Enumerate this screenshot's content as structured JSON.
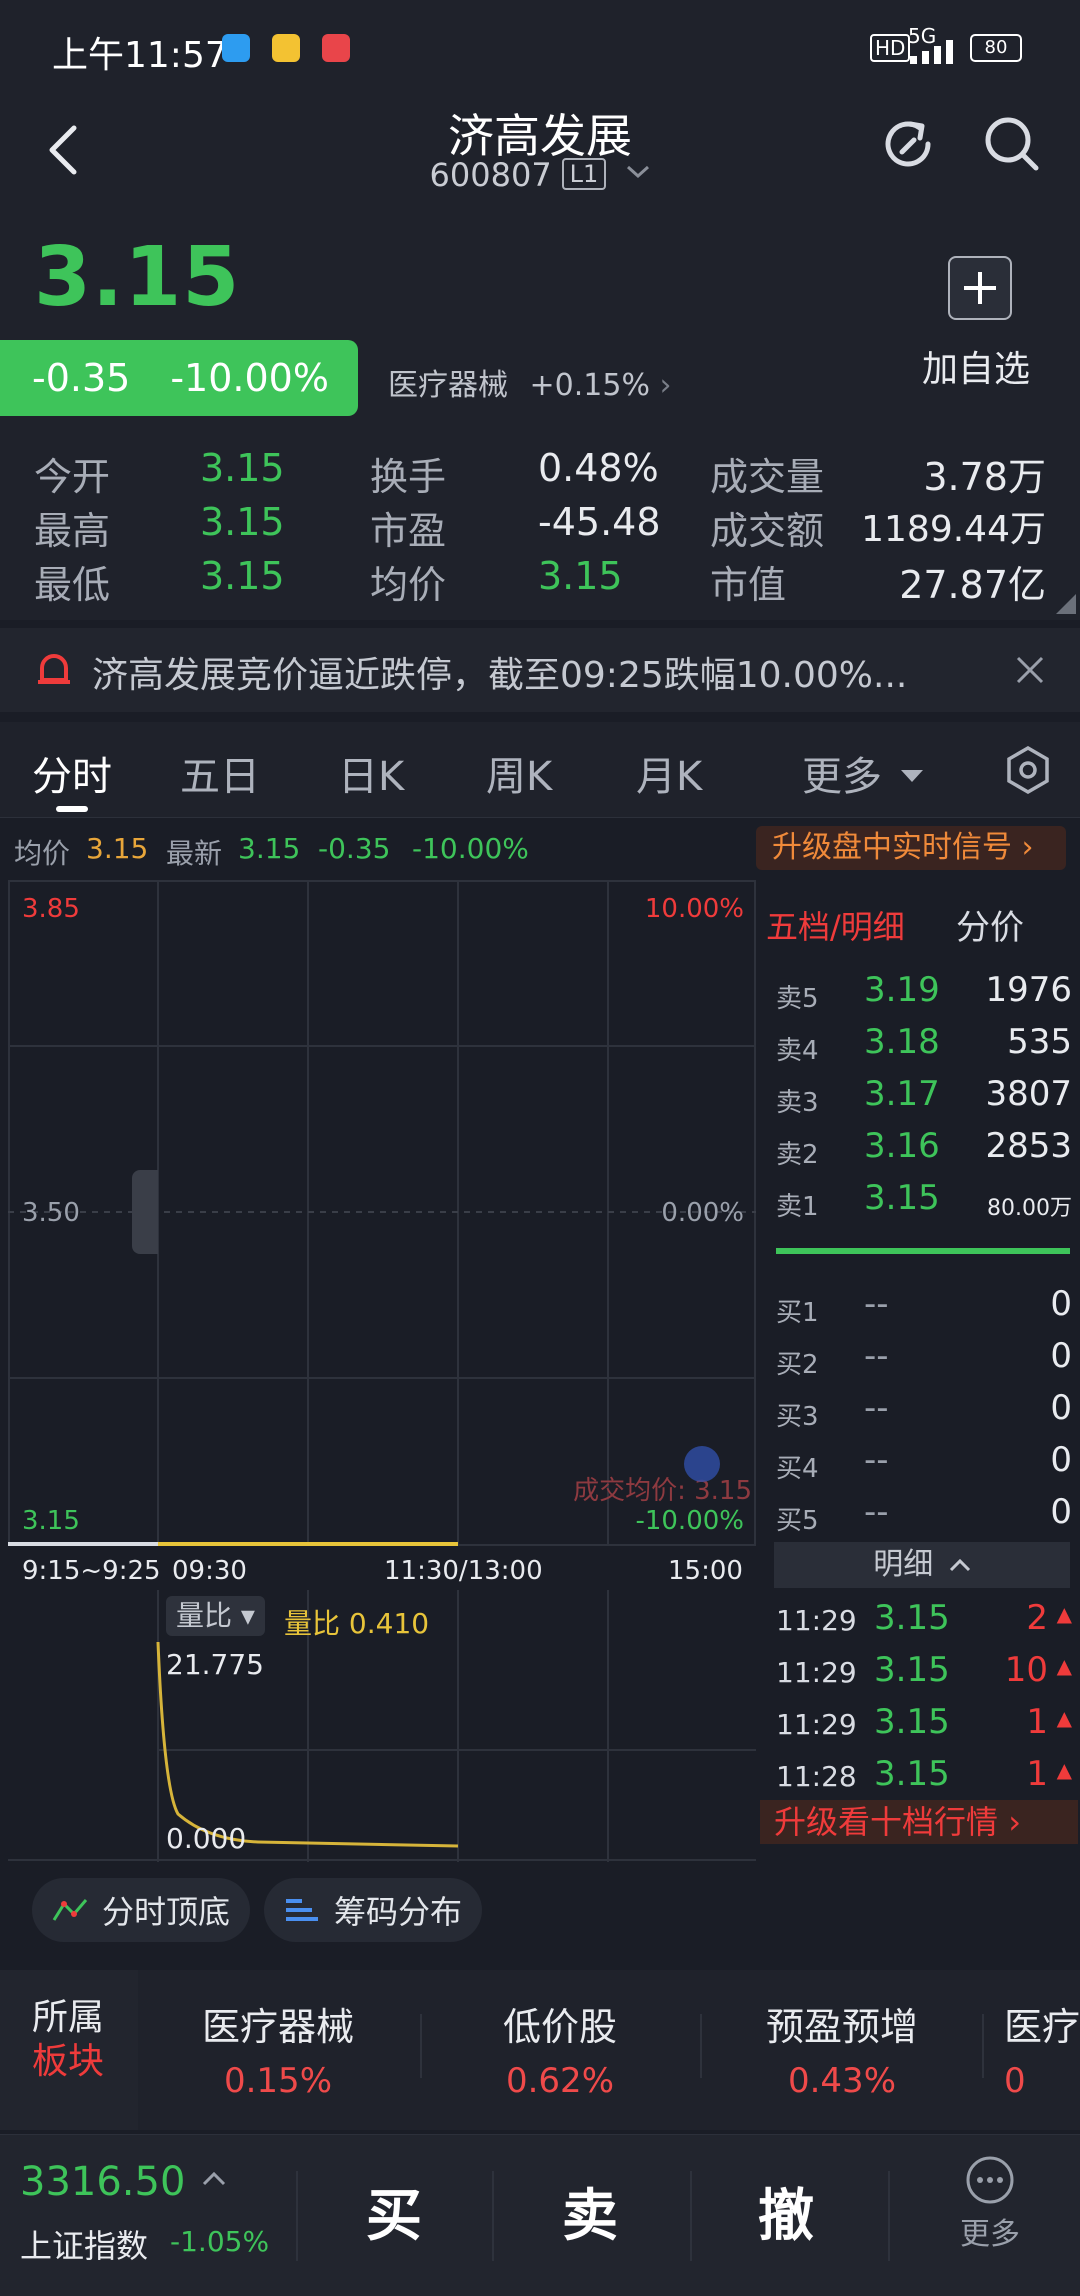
{
  "status_bar": {
    "time": "上午11:57",
    "network": "5G",
    "battery": "80"
  },
  "header": {
    "stock_name": "济高发展",
    "stock_code": "600807",
    "level": "L1"
  },
  "quote": {
    "price": "3.15",
    "change": "-0.35",
    "change_pct": "-10.00%",
    "sector": "医疗器械",
    "sector_chg": "+0.15%",
    "add_fav_label": "加自选",
    "stats": [
      {
        "label": "今开",
        "value": "3.15",
        "color": "green"
      },
      {
        "label": "最高",
        "value": "3.15",
        "color": "green"
      },
      {
        "label": "最低",
        "value": "3.15",
        "color": "green"
      },
      {
        "label": "换手",
        "value": "0.48%",
        "color": "white"
      },
      {
        "label": "市盈",
        "value": "-45.48",
        "color": "white"
      },
      {
        "label": "均价",
        "value": "3.15",
        "color": "green"
      },
      {
        "label": "成交量",
        "value": "3.78万",
        "color": "white"
      },
      {
        "label": "成交额",
        "value": "1189.44万",
        "color": "white"
      },
      {
        "label": "市值",
        "value": "27.87亿",
        "color": "white"
      }
    ]
  },
  "alert": {
    "text": "济高发展竞价逼近跌停，截至09:25跌幅10.00%..."
  },
  "tabs": [
    "分时",
    "五日",
    "日K",
    "周K",
    "月K",
    "更多"
  ],
  "info_line": {
    "avg_label": "均价",
    "avg_value": "3.15",
    "latest_label": "最新",
    "latest_value": "3.15",
    "change": "-0.35",
    "change_pct": "-10.00%",
    "upgrade_signal": "升级盘中实时信号"
  },
  "chart": {
    "y_top": "3.85",
    "y_mid": "3.50",
    "y_bottom": "3.15",
    "pct_top": "10.00%",
    "pct_mid": "0.00%",
    "pct_bottom": "-10.00%",
    "avg_label": "成交均价: 3.15",
    "x_labels": [
      "9:15~9:25",
      "09:30",
      "11:30/13:00",
      "15:00"
    ]
  },
  "volume_chart": {
    "selector": "量比",
    "ratio_label": "量比",
    "ratio_value": "0.410",
    "max": "21.775",
    "min": "0.000"
  },
  "orderbook": {
    "tab_active": "五档/明细",
    "tab_other": "分价",
    "asks": [
      {
        "label": "卖5",
        "price": "3.19",
        "vol": "1976"
      },
      {
        "label": "卖4",
        "price": "3.18",
        "vol": "535"
      },
      {
        "label": "卖3",
        "price": "3.17",
        "vol": "3807"
      },
      {
        "label": "卖2",
        "price": "3.16",
        "vol": "2853"
      },
      {
        "label": "卖1",
        "price": "3.15",
        "vol": "80.00万"
      }
    ],
    "bids": [
      {
        "label": "买1",
        "price": "--",
        "vol": "0"
      },
      {
        "label": "买2",
        "price": "--",
        "vol": "0"
      },
      {
        "label": "买3",
        "price": "--",
        "vol": "0"
      },
      {
        "label": "买4",
        "price": "--",
        "vol": "0"
      },
      {
        "label": "买5",
        "price": "--",
        "vol": "0"
      }
    ],
    "detail_label": "明细",
    "trades": [
      {
        "time": "11:29",
        "price": "3.15",
        "vol": "2"
      },
      {
        "time": "11:29",
        "price": "3.15",
        "vol": "10"
      },
      {
        "time": "11:29",
        "price": "3.15",
        "vol": "1"
      },
      {
        "time": "11:28",
        "price": "3.15",
        "vol": "1"
      }
    ],
    "upgrade_ten": "升级看十档行情"
  },
  "chips": [
    "分时顶底",
    "筹码分布"
  ],
  "sectors": {
    "title_1": "所属",
    "title_2": "板块",
    "items": [
      {
        "name": "医疗器械",
        "chg": "0.15%"
      },
      {
        "name": "低价股",
        "chg": "0.62%"
      },
      {
        "name": "预盈预增",
        "chg": "0.43%"
      },
      {
        "name": "医疗",
        "chg": "0"
      }
    ]
  },
  "bottom": {
    "index_value": "3316.50",
    "index_name": "上证指数",
    "index_chg": "-1.05%",
    "buy": "买",
    "sell": "卖",
    "cancel": "撤",
    "more": "更多"
  }
}
